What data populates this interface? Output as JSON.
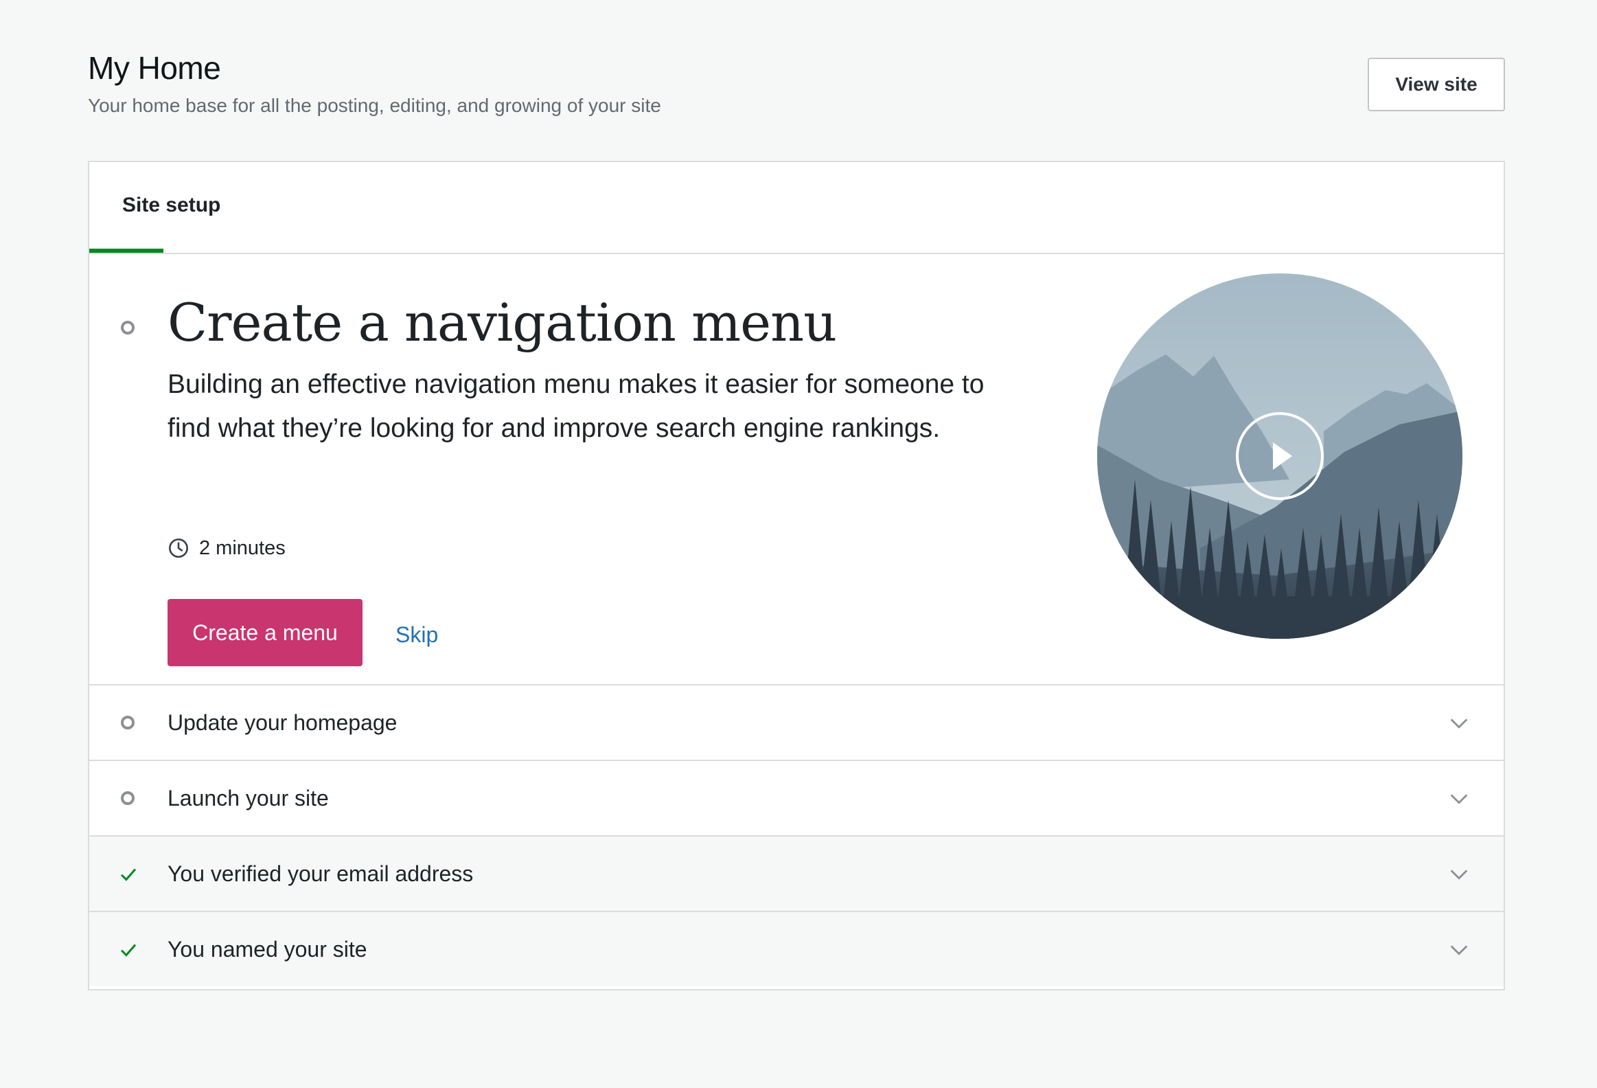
{
  "header": {
    "title": "My Home",
    "subtitle": "Your home base for all the posting, editing, and growing of your site",
    "view_site_label": "View site"
  },
  "tabs": [
    {
      "label": "Site setup",
      "active": true
    }
  ],
  "active_task": {
    "title": "Create a navigation menu",
    "description": "Building an effective navigation menu makes it easier for someone to find what they’re looking for and improve search engine rankings.",
    "duration": "2 minutes",
    "primary_action": "Create a menu",
    "secondary_action": "Skip",
    "media_icon": "play-icon"
  },
  "tasks": [
    {
      "label": "Update your homepage",
      "status": "pending"
    },
    {
      "label": "Launch your site",
      "status": "pending"
    },
    {
      "label": "You verified your email address",
      "status": "completed"
    },
    {
      "label": "You named your site",
      "status": "completed"
    }
  ],
  "colors": {
    "background": "#f6f7f7",
    "primary_button": "#c9356e",
    "link": "#2271b1",
    "active_tab_underline": "#008a20",
    "check": "#008a20"
  }
}
